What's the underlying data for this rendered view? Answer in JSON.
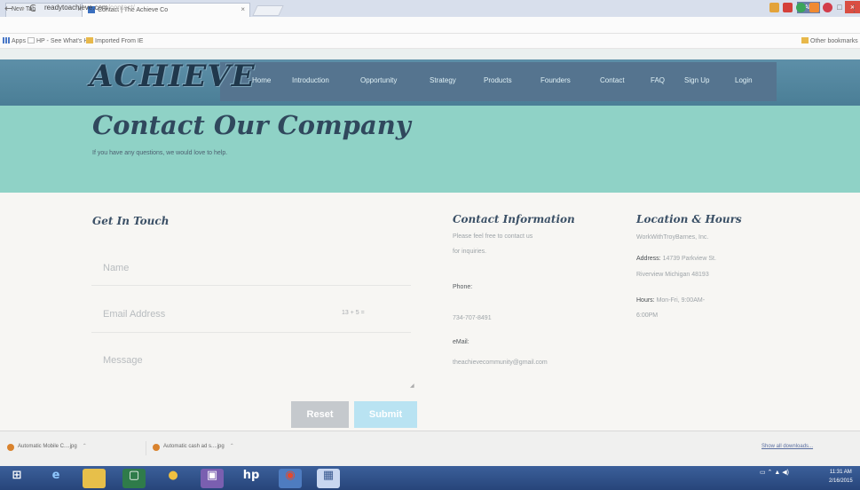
{
  "browser": {
    "tabs": [
      {
        "label": "New Tab"
      },
      {
        "label": "Contact | The Achieve Co"
      }
    ],
    "profile_label": "AB",
    "url_host": "readytoachieve.com",
    "url_path": "/contact/",
    "bookmarks": [
      "Apps",
      "HP - See What's Hot",
      "Imported From IE"
    ],
    "other_bookmarks": "Other bookmarks"
  },
  "site": {
    "logo": "ACHIEVE",
    "nav": [
      "Home",
      "Introduction",
      "Opportunity",
      "Strategy",
      "Products",
      "Founders",
      "Contact",
      "FAQ",
      "Sign Up",
      "Login"
    ],
    "hero": {
      "title": "Contact Our Company",
      "subtitle": "If you have any questions, we would love to help."
    },
    "form": {
      "heading": "Get In Touch",
      "name_placeholder": "Name",
      "email_placeholder": "Email Address",
      "captcha": "13 + 5 =",
      "message_placeholder": "Message",
      "reset_label": "Reset",
      "submit_label": "Submit"
    },
    "contact": {
      "heading": "Contact Information",
      "intro_line1": "Please feel free to contact us",
      "intro_line2": "for inquiries.",
      "phone_label": "Phone:",
      "phone": "734-707-8491",
      "email_label": "eMail:",
      "email": "theachievecommunity@gmail.com"
    },
    "location": {
      "heading": "Location & Hours",
      "company": "WorkWithTroyBarnes, Inc.",
      "address_label": "Address:",
      "address_line1": "14739 Parkview St.",
      "address_line2": "Riverview Michigan 48193",
      "hours_label": "Hours:",
      "hours_line1": "Mon-Fri, 9:00AM-",
      "hours_line2": "6:00PM"
    }
  },
  "downloads": {
    "items": [
      "Automatic Mobile C....jpg",
      "Automatic cash ad s....jpg"
    ],
    "show_all": "Show all downloads..."
  },
  "taskbar": {
    "time": "11:31 AM",
    "date": "2/16/2015"
  }
}
